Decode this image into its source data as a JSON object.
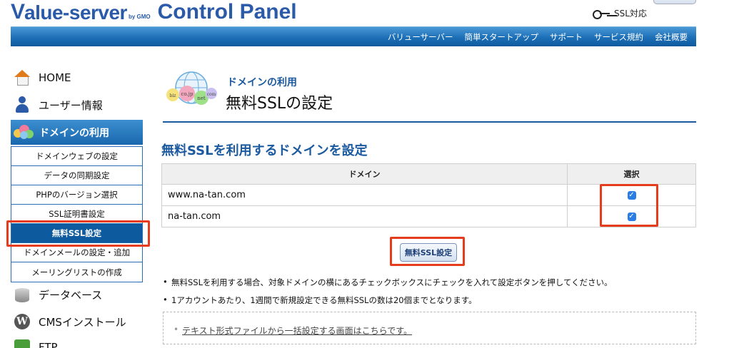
{
  "header": {
    "logo_main": "alue-server",
    "logo_gmo": "by GMO",
    "panel_title": "Control Panel",
    "ssl_link": "SSL対応"
  },
  "nav": [
    "バリューサーバー",
    "簡単スタートアップ",
    "サポート",
    "サービス規約",
    "会社概要"
  ],
  "sidebar": {
    "home": "HOME",
    "user_info": "ユーザー情報",
    "domain_use": "ドメインの利用",
    "sub_items": [
      "ドメインウェブの設定",
      "データの同期設定",
      "PHPのバージョン選択",
      "SSL証明書設定",
      "無料SSL設定",
      "ドメインメールの設定・追加",
      "メーリングリストの作成"
    ],
    "active_sub_index": 4,
    "database": "データベース",
    "cms_install": "CMSインストール",
    "ftp": "FTP"
  },
  "main": {
    "section": "ドメインの利用",
    "page_title": "無料SSLの設定",
    "heading": "無料SSLを利用するドメインを設定",
    "table": {
      "col_domain": "ドメイン",
      "col_select": "選択",
      "rows": [
        {
          "domain": "www.na-tan.com",
          "checked": true
        },
        {
          "domain": "na-tan.com",
          "checked": true
        }
      ]
    },
    "submit_label": "無料SSL設定",
    "notes": [
      "無料SSLを利用する場合、対象ドメインの横にあるチェックボックスにチェックを入れて設定ボタンを押してください。",
      "1アカウントあたり、1週間で新規設定できる無料SSLの数は20個までとなります。"
    ],
    "bulk_link": "テキスト形式ファイルから一括設定する画面はこちらです。"
  },
  "colors": {
    "brand": "#2a5aa8",
    "nav_bg": "#1c6fb6",
    "highlight": "#e63c1e"
  }
}
